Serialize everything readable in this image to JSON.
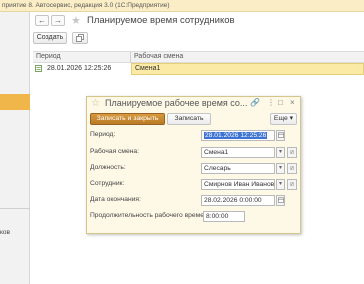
{
  "window": {
    "title": "приятие 8. Автосервис, редакция 3.0  (1С:Предприятие)"
  },
  "left_panel": {
    "item_text": "ков"
  },
  "form": {
    "title": "Планируемое время сотрудников",
    "nav": {
      "back": "←",
      "forward": "→"
    },
    "toolbar": {
      "create_label": "Создать",
      "copy_icon": "copy-icon"
    },
    "list": {
      "columns": [
        "Период",
        "Рабочая смена"
      ],
      "rows": [
        {
          "period": "28.01.2026 12:25:26",
          "shift": "Смена1"
        }
      ]
    }
  },
  "dialog": {
    "title": "Планируемое рабочее время со...",
    "controls": {
      "link": "🔗",
      "menu": "⋮",
      "maximize": "□",
      "close": "×"
    },
    "buttons": {
      "save_close": "Записать и закрыть",
      "save": "Записать",
      "more": "Еще"
    },
    "fields": {
      "period": {
        "label": "Период:",
        "value": "28.01.2026 12:25:26"
      },
      "shift": {
        "label": "Рабочая смена:",
        "value": "Смена1"
      },
      "position": {
        "label": "Должность:",
        "value": "Слесарь"
      },
      "employee": {
        "label": "Сотрудник:",
        "value": "Смирнов Иван Иванович"
      },
      "end_date": {
        "label": "Дата окончания:",
        "value": "28.02.2026  0:00:00"
      },
      "duration": {
        "label": "Продолжительность рабочего времени:",
        "value": "8:00:00"
      }
    }
  },
  "colors": {
    "accent": "#f0b64a",
    "selected_row": "#fbe9a6",
    "dialog_bg": "#fef9e7",
    "primary_button": "#c88a32",
    "selection": "#3d73d4"
  }
}
